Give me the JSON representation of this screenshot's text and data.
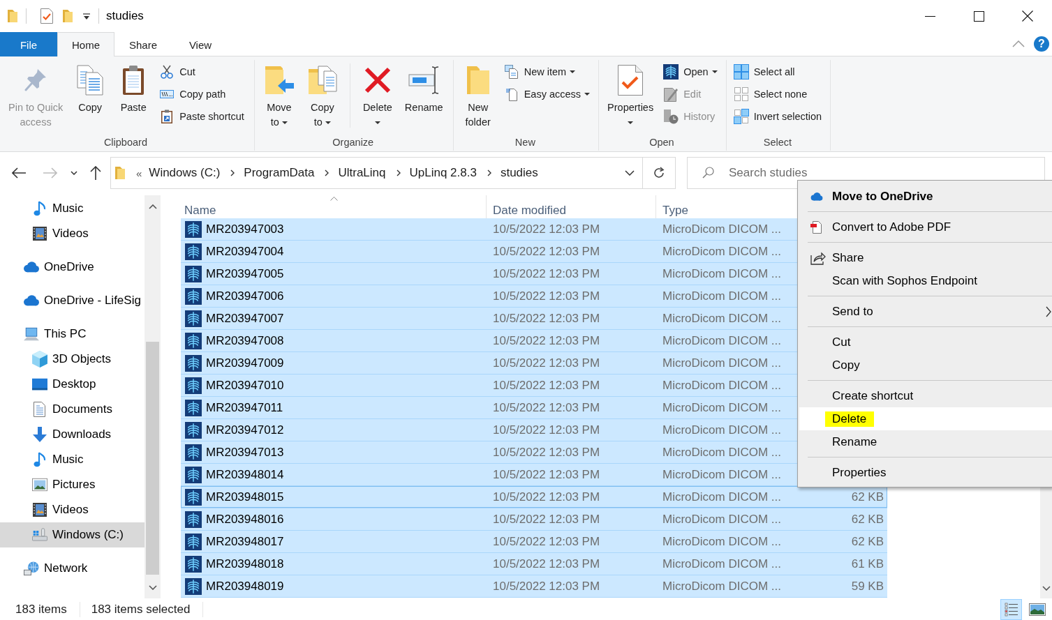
{
  "window": {
    "title": "studies"
  },
  "tabs": [
    {
      "label": "File",
      "kind": "menu",
      "selected": false
    },
    {
      "label": "Home",
      "kind": "tab",
      "selected": true
    },
    {
      "label": "Share",
      "kind": "tab",
      "selected": false
    },
    {
      "label": "View",
      "kind": "tab",
      "selected": false
    }
  ],
  "help_button": {
    "label": "?"
  },
  "ribbon": {
    "groups": [
      {
        "label": "Clipboard",
        "commands": [
          {
            "kind": "large",
            "lines": [
              "Pin to Quick",
              "access"
            ],
            "disabled": true,
            "dropdown": false
          },
          {
            "kind": "large",
            "lines": [
              "Copy"
            ],
            "disabled": false,
            "dropdown": false
          },
          {
            "kind": "large",
            "lines": [
              "Paste"
            ],
            "disabled": false,
            "dropdown": false
          },
          {
            "kind": "small",
            "label": "Cut",
            "disabled": false,
            "dropdown": false
          },
          {
            "kind": "small",
            "label": "Copy path",
            "disabled": false,
            "dropdown": false
          },
          {
            "kind": "small",
            "label": "Paste shortcut",
            "disabled": false,
            "dropdown": false
          }
        ]
      },
      {
        "label": "Organize",
        "commands": [
          {
            "kind": "large",
            "lines": [
              "Move",
              "to"
            ],
            "disabled": false,
            "dropdown": true
          },
          {
            "kind": "large",
            "lines": [
              "Copy",
              "to"
            ],
            "disabled": false,
            "dropdown": true
          },
          {
            "kind": "separator"
          },
          {
            "kind": "large",
            "lines": [
              "Delete"
            ],
            "disabled": false,
            "dropdown": true
          },
          {
            "kind": "large",
            "lines": [
              "Rename"
            ],
            "disabled": false,
            "dropdown": false
          }
        ]
      },
      {
        "label": "New",
        "commands": [
          {
            "kind": "large",
            "lines": [
              "New",
              "folder"
            ],
            "disabled": false,
            "dropdown": false
          },
          {
            "kind": "small",
            "label": "New item",
            "disabled": false,
            "dropdown": true
          },
          {
            "kind": "small",
            "label": "Easy access",
            "disabled": false,
            "dropdown": true
          }
        ]
      },
      {
        "label": "Open",
        "commands": [
          {
            "kind": "large",
            "lines": [
              "Properties"
            ],
            "disabled": false,
            "dropdown": true
          },
          {
            "kind": "small",
            "label": "Open",
            "disabled": false,
            "dropdown": true
          },
          {
            "kind": "small",
            "label": "Edit",
            "disabled": true,
            "dropdown": false
          },
          {
            "kind": "small",
            "label": "History",
            "disabled": true,
            "dropdown": false
          }
        ]
      },
      {
        "label": "Select",
        "commands": [
          {
            "kind": "small",
            "label": "Select all",
            "disabled": false,
            "dropdown": false
          },
          {
            "kind": "small",
            "label": "Select none",
            "disabled": false,
            "dropdown": false
          },
          {
            "kind": "small",
            "label": "Invert selection",
            "disabled": false,
            "dropdown": false
          }
        ]
      }
    ]
  },
  "history_buttons": [
    {
      "disabled": false
    },
    {
      "disabled": true
    },
    {
      "disabled": false
    },
    {
      "disabled": false
    }
  ],
  "address_bar": {
    "overflow": "«",
    "segments": [
      "Windows (C:)",
      "ProgramData",
      "UltraLinq",
      "UpLinq 2.8.3",
      "studies"
    ]
  },
  "search": {
    "placeholder": "Search studies"
  },
  "navigation_pane": {
    "items": [
      {
        "children": [
          {
            "kind": "music",
            "label": "Music",
            "selected": false
          },
          {
            "kind": "videos",
            "label": "Videos",
            "selected": false
          }
        ]
      },
      {
        "kind": "onedrive",
        "label": "OneDrive",
        "selected": false
      },
      {
        "kind": "onedrive",
        "label": "OneDrive - LifeSig",
        "selected": false
      },
      {
        "kind": "pc",
        "label": "This PC",
        "selected": false,
        "children": [
          {
            "kind": "objects3d",
            "label": "3D Objects",
            "selected": false
          },
          {
            "kind": "desktop",
            "label": "Desktop",
            "selected": false
          },
          {
            "kind": "documents",
            "label": "Documents",
            "selected": false
          },
          {
            "kind": "downloads",
            "label": "Downloads",
            "selected": false
          },
          {
            "kind": "music",
            "label": "Music",
            "selected": false
          },
          {
            "kind": "pictures",
            "label": "Pictures",
            "selected": false
          },
          {
            "kind": "videos",
            "label": "Videos",
            "selected": false
          },
          {
            "kind": "drive",
            "label": "Windows (C:)",
            "selected": true
          }
        ]
      },
      {
        "kind": "network",
        "label": "Network",
        "selected": false
      }
    ]
  },
  "file_list": {
    "columns": [
      {
        "label": "Name",
        "sorted": true
      },
      {
        "label": "Date modified",
        "sorted": false
      },
      {
        "label": "Type",
        "sorted": false
      }
    ],
    "rows": [
      {
        "cells": [
          "MR203947003",
          "10/5/2022 12:03 PM",
          "MicroDicom DICOM ..."
        ],
        "selected": true,
        "focused": false
      },
      {
        "cells": [
          "MR203947004",
          "10/5/2022 12:03 PM",
          "MicroDicom DICOM ..."
        ],
        "selected": true,
        "focused": false
      },
      {
        "cells": [
          "MR203947005",
          "10/5/2022 12:03 PM",
          "MicroDicom DICOM ..."
        ],
        "selected": true,
        "focused": false
      },
      {
        "cells": [
          "MR203947006",
          "10/5/2022 12:03 PM",
          "MicroDicom DICOM ..."
        ],
        "selected": true,
        "focused": false
      },
      {
        "cells": [
          "MR203947007",
          "10/5/2022 12:03 PM",
          "MicroDicom DICOM ..."
        ],
        "selected": true,
        "focused": false
      },
      {
        "cells": [
          "MR203947008",
          "10/5/2022 12:03 PM",
          "MicroDicom DICOM ..."
        ],
        "selected": true,
        "focused": false
      },
      {
        "cells": [
          "MR203947009",
          "10/5/2022 12:03 PM",
          "MicroDicom DICOM ..."
        ],
        "selected": true,
        "focused": false
      },
      {
        "cells": [
          "MR203947010",
          "10/5/2022 12:03 PM",
          "MicroDicom DICOM ..."
        ],
        "selected": true,
        "focused": false
      },
      {
        "cells": [
          "MR203947011",
          "10/5/2022 12:03 PM",
          "MicroDicom DICOM ..."
        ],
        "selected": true,
        "focused": false
      },
      {
        "cells": [
          "MR203947012",
          "10/5/2022 12:03 PM",
          "MicroDicom DICOM ..."
        ],
        "selected": true,
        "focused": false
      },
      {
        "cells": [
          "MR203947013",
          "10/5/2022 12:03 PM",
          "MicroDicom DICOM ..."
        ],
        "selected": true,
        "focused": false
      },
      {
        "cells": [
          "MR203948014",
          "10/5/2022 12:03 PM",
          "MicroDicom DICOM ..."
        ],
        "selected": true,
        "focused": false
      },
      {
        "cells": [
          "MR203948015",
          "10/5/2022 12:03 PM",
          "MicroDicom DICOM ...",
          "62 KB"
        ],
        "selected": true,
        "focused": true
      },
      {
        "cells": [
          "MR203948016",
          "10/5/2022 12:03 PM",
          "MicroDicom DICOM ...",
          "62 KB"
        ],
        "selected": true,
        "focused": false
      },
      {
        "cells": [
          "MR203948017",
          "10/5/2022 12:03 PM",
          "MicroDicom DICOM ...",
          "62 KB"
        ],
        "selected": true,
        "focused": false
      },
      {
        "cells": [
          "MR203948018",
          "10/5/2022 12:03 PM",
          "MicroDicom DICOM ...",
          "61 KB"
        ],
        "selected": true,
        "focused": false
      },
      {
        "cells": [
          "MR203948019",
          "10/5/2022 12:03 PM",
          "MicroDicom DICOM ...",
          "59 KB"
        ],
        "selected": true,
        "focused": false
      }
    ]
  },
  "context_menu": {
    "groups": [
      {
        "items": [
          {
            "label": "Move to OneDrive",
            "default": true,
            "selected": false,
            "highlighted": false,
            "submenu": false
          }
        ]
      },
      {
        "items": [
          {
            "label": "Convert to Adobe PDF",
            "default": false,
            "selected": false,
            "highlighted": false,
            "submenu": false
          }
        ]
      },
      {
        "items": [
          {
            "label": "Share",
            "default": false,
            "selected": false,
            "highlighted": false,
            "submenu": false
          },
          {
            "label": "Scan with Sophos Endpoint",
            "default": false,
            "selected": false,
            "highlighted": false,
            "submenu": false
          }
        ]
      },
      {
        "items": [
          {
            "label": "Send to",
            "default": false,
            "selected": false,
            "highlighted": false,
            "submenu": true
          }
        ]
      },
      {
        "items": [
          {
            "label": "Cut",
            "default": false,
            "selected": false,
            "highlighted": false,
            "submenu": false
          },
          {
            "label": "Copy",
            "default": false,
            "selected": false,
            "highlighted": false,
            "submenu": false
          }
        ]
      },
      {
        "items": [
          {
            "label": "Create shortcut",
            "default": false,
            "selected": false,
            "highlighted": false,
            "submenu": false
          },
          {
            "label": "Delete",
            "default": false,
            "selected": true,
            "highlighted": true,
            "submenu": false
          },
          {
            "label": "Rename",
            "default": false,
            "selected": false,
            "highlighted": false,
            "submenu": false
          }
        ]
      },
      {
        "items": [
          {
            "label": "Properties",
            "default": false,
            "selected": false,
            "highlighted": false,
            "submenu": false
          }
        ]
      }
    ]
  },
  "status_bar": {
    "item_count": "183 items",
    "selection_count": "183 items selected",
    "views": [
      {
        "selected": true
      },
      {
        "selected": false
      }
    ]
  }
}
